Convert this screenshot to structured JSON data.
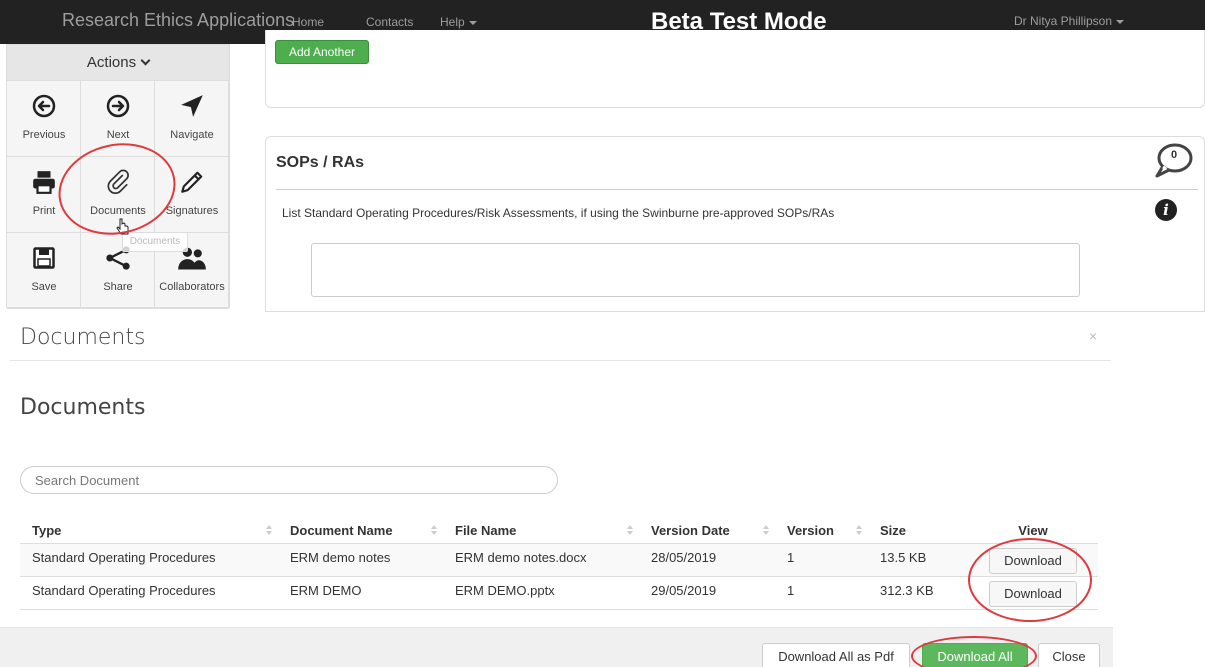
{
  "navbar": {
    "brand": "Research Ethics Applications",
    "links": [
      "Home",
      "Contacts",
      "Help"
    ],
    "banner": "Beta Test Mode",
    "user": "Dr Nitya Phillipson"
  },
  "actions": {
    "header": "Actions",
    "items": [
      {
        "label": "Previous",
        "icon": "arrow-left-circle-icon"
      },
      {
        "label": "Next",
        "icon": "arrow-right-circle-icon"
      },
      {
        "label": "Navigate",
        "icon": "navigate-arrow-icon"
      },
      {
        "label": "Print",
        "icon": "printer-icon"
      },
      {
        "label": "Documents",
        "icon": "paperclip-icon"
      },
      {
        "label": "Signatures",
        "icon": "pencil-icon"
      },
      {
        "label": "Save",
        "icon": "floppy-disk-icon"
      },
      {
        "label": "Share",
        "icon": "share-icon"
      },
      {
        "label": "Collaborators",
        "icon": "users-icon"
      }
    ],
    "tooltip": "Documents"
  },
  "form": {
    "add_another": "Add Another",
    "section_title": "SOPs / RAs",
    "comment_count": "0",
    "description": "List Standard Operating Procedures/Risk Assessments, if using the Swinburne pre-approved SOPs/RAs"
  },
  "modal": {
    "title": "Documents",
    "close": "×",
    "subtitle": "Documents",
    "search_placeholder": "Search Document",
    "columns": [
      "Type",
      "Document Name",
      "File Name",
      "Version Date",
      "Version",
      "Size",
      "View"
    ],
    "rows": [
      {
        "type": "Standard Operating Procedures",
        "name": "ERM demo notes",
        "file": "ERM demo notes.docx",
        "date": "28/05/2019",
        "version": "1",
        "size": "13.5 KB",
        "view": "Download"
      },
      {
        "type": "Standard Operating Procedures",
        "name": "ERM DEMO",
        "file": "ERM DEMO.pptx",
        "date": "29/05/2019",
        "version": "1",
        "size": "312.3 KB",
        "view": "Download"
      }
    ],
    "footer": {
      "download_pdf": "Download All as Pdf",
      "download_all": "Download All",
      "close": "Close"
    }
  },
  "colors": {
    "navbar": "#222222",
    "primary_green": "#5cb85c",
    "annotation_red": "#e0393e"
  }
}
